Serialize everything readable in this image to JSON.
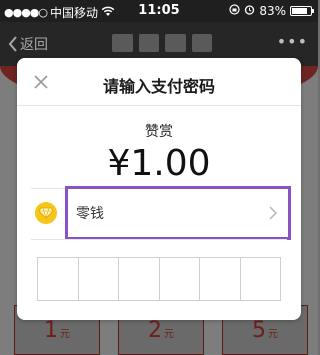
{
  "status_bar": {
    "signal_dots": "●●●●○",
    "carrier": "中国移动",
    "wifi_icon": "wifi-icon",
    "time": "11:05",
    "battery_percent": "83%",
    "battery_level": 0.83
  },
  "nav_bar": {
    "back_label": "返回",
    "title": "",
    "more_label": "•••"
  },
  "background": {
    "amount_options": [
      {
        "value": "1",
        "unit": "元"
      },
      {
        "value": "2",
        "unit": "元"
      },
      {
        "value": "5",
        "unit": "元"
      }
    ]
  },
  "dialog": {
    "title": "请输入支付密码",
    "subtitle": "赞赏",
    "amount": "¥1.00",
    "payment_method": {
      "label": "零钱",
      "icon": "coin-icon"
    },
    "pin_length": 6
  },
  "colors": {
    "highlight_border": "#8a52c8",
    "coin": "#f5c518",
    "overlay": "#6f6f6f"
  }
}
